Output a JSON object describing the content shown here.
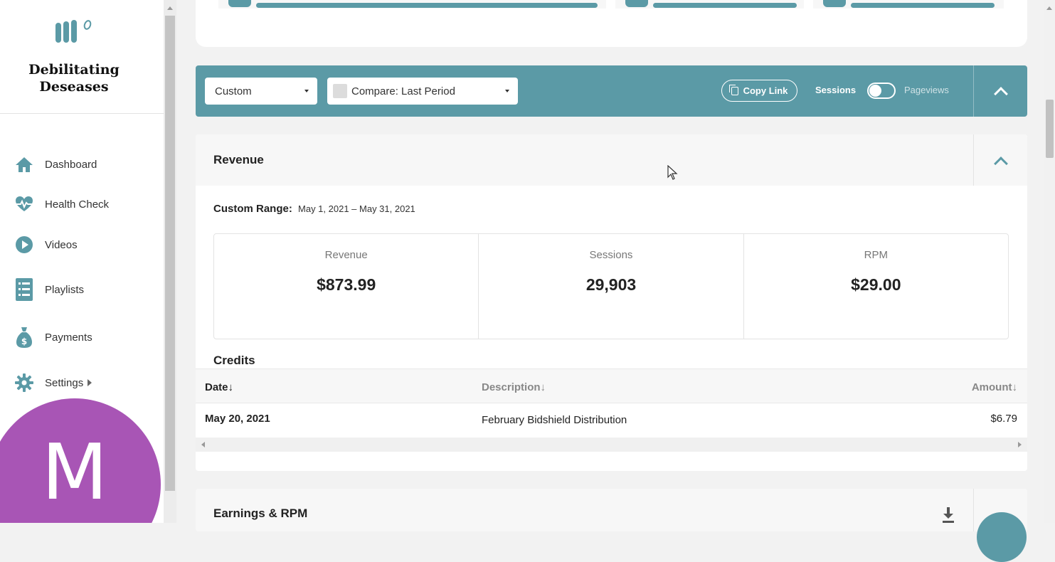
{
  "brand": {
    "site_name": "Debilitating Deseases",
    "accent": "#5b9aa6",
    "avatar_color": "#a855b5"
  },
  "sidebar": {
    "items": [
      {
        "label": "Dashboard",
        "icon": "home-icon"
      },
      {
        "label": "Health Check",
        "icon": "heartbeat-icon"
      },
      {
        "label": "Videos",
        "icon": "play-circle-icon"
      },
      {
        "label": "Playlists",
        "icon": "list-icon"
      },
      {
        "label": "Payments",
        "icon": "money-bag-icon"
      },
      {
        "label": "Settings",
        "icon": "gear-icon"
      }
    ],
    "avatar_letter": "M"
  },
  "toolbar": {
    "date_select": "Custom",
    "compare_select": "Compare: Last Period",
    "copy_link": "Copy Link",
    "toggle_left": "Sessions",
    "toggle_right": "Pageviews"
  },
  "revenue": {
    "title": "Revenue",
    "range_label": "Custom Range:",
    "range_value": "May 1, 2021 – May 31, 2021",
    "stats": [
      {
        "label": "Revenue",
        "value": "$873.99"
      },
      {
        "label": "Sessions",
        "value": "29,903"
      },
      {
        "label": "RPM",
        "value": "$29.00"
      }
    ]
  },
  "credits": {
    "title": "Credits",
    "columns": [
      "Date",
      "Description",
      "Amount"
    ],
    "rows": [
      {
        "date": "May 20, 2021",
        "description": "February Bidshield Distribution",
        "amount": "$6.79"
      }
    ]
  },
  "earnings": {
    "title": "Earnings & RPM"
  }
}
